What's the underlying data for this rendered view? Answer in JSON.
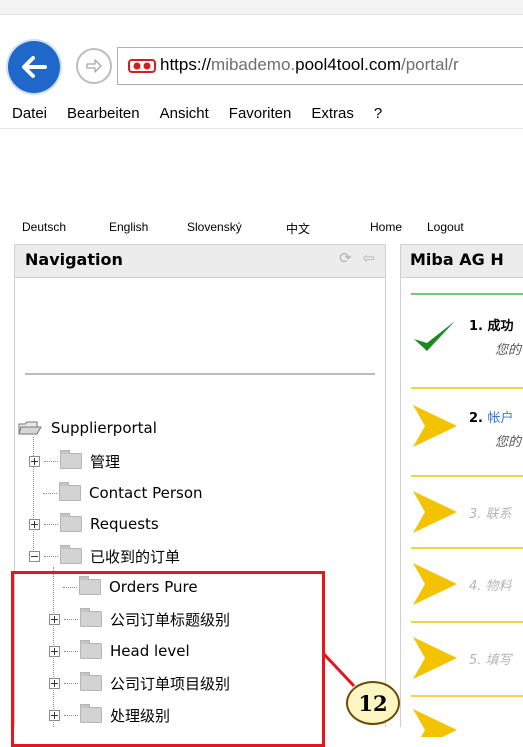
{
  "browser": {
    "address": {
      "scheme": "https://",
      "sub": "mibademo.",
      "domain": "pool4tool.com",
      "path": "/portal/r"
    },
    "menu": [
      "Datei",
      "Bearbeiten",
      "Ansicht",
      "Favoriten",
      "Extras",
      "?"
    ]
  },
  "langbar": {
    "items": [
      "Deutsch",
      "English",
      "Slovenský",
      "中文",
      "Home",
      "Logout"
    ]
  },
  "nav": {
    "title": "Navigation",
    "root": "Supplierportal",
    "items": [
      "管理",
      "Contact Person",
      "Requests",
      "已收到的订单",
      "Orders Pure",
      "公司订单标题级别",
      "Head level",
      "公司订单项目级别",
      "处理级别"
    ]
  },
  "right": {
    "title": "Miba AG H",
    "steps": [
      {
        "num": "1.",
        "label": "成功",
        "sub": "您的"
      },
      {
        "num": "2.",
        "label": "帐户",
        "sub": "您的"
      },
      {
        "num": "3.",
        "label": "联系"
      },
      {
        "num": "4.",
        "label": "物料"
      },
      {
        "num": "5.",
        "label": "填写"
      }
    ]
  },
  "annotation": {
    "badge": "12"
  },
  "colors": {
    "back_button": "#1f67c9",
    "highlight": "#e8151c",
    "check": "#1e8a1e",
    "arrow": "#f4c300"
  }
}
